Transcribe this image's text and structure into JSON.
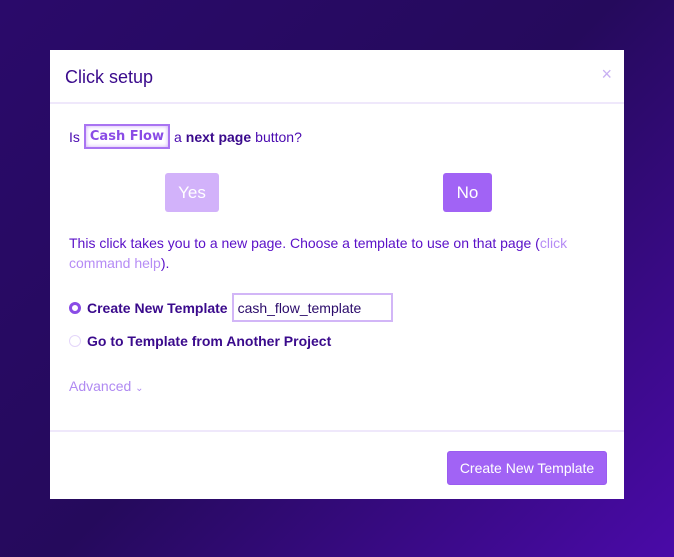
{
  "dialog": {
    "title": "Click setup",
    "close_icon": "×"
  },
  "question": {
    "prefix": "Is",
    "element": "Cash Flow",
    "middle": "a",
    "bold": "next page",
    "suffix": "button?"
  },
  "buttons": {
    "yes": "Yes",
    "no": "No"
  },
  "info": {
    "text": "This click takes you to a new page. Choose a template to use on that page (",
    "link_text": "click command help",
    "end": ")."
  },
  "options": [
    {
      "label": "Create New Template",
      "selected": true,
      "input_value": "cash_flow_template"
    },
    {
      "label": "Go to Template from Another Project",
      "selected": false
    }
  ],
  "advanced": {
    "label": "Advanced",
    "icon": "chevron-down"
  },
  "footer": {
    "submit": "Create New Template"
  }
}
